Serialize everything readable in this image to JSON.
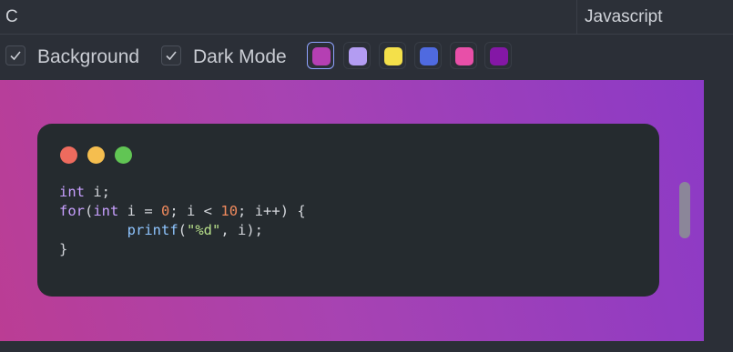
{
  "header": {
    "language_left": "C",
    "language_right": "Javascript"
  },
  "toolbar": {
    "background_label": "Background",
    "background_checked": true,
    "dark_mode_label": "Dark Mode",
    "dark_mode_checked": true,
    "swatches": [
      {
        "name": "magenta-purple",
        "color": "#b53fb3",
        "selected": true
      },
      {
        "name": "lavender",
        "color": "#b39cf2",
        "selected": false
      },
      {
        "name": "yellow",
        "color": "#f4e04a",
        "selected": false
      },
      {
        "name": "blue",
        "color": "#4f6ae0",
        "selected": false
      },
      {
        "name": "pink",
        "color": "#e84fa8",
        "selected": false
      },
      {
        "name": "purple",
        "color": "#8417a6",
        "selected": false
      }
    ]
  },
  "window": {
    "buttons": [
      "#ee6b5e",
      "#f5be4f",
      "#61c554"
    ]
  },
  "code": {
    "lines": [
      "int i;",
      "for(int i = 0; i < 10; i++) {",
      "        printf(\"%d\", i);",
      "}"
    ]
  },
  "colors": {
    "canvas_gradient_start": "#bb3d94",
    "canvas_gradient_end": "#8c3ac6",
    "editor_bg": "#252b2f"
  }
}
